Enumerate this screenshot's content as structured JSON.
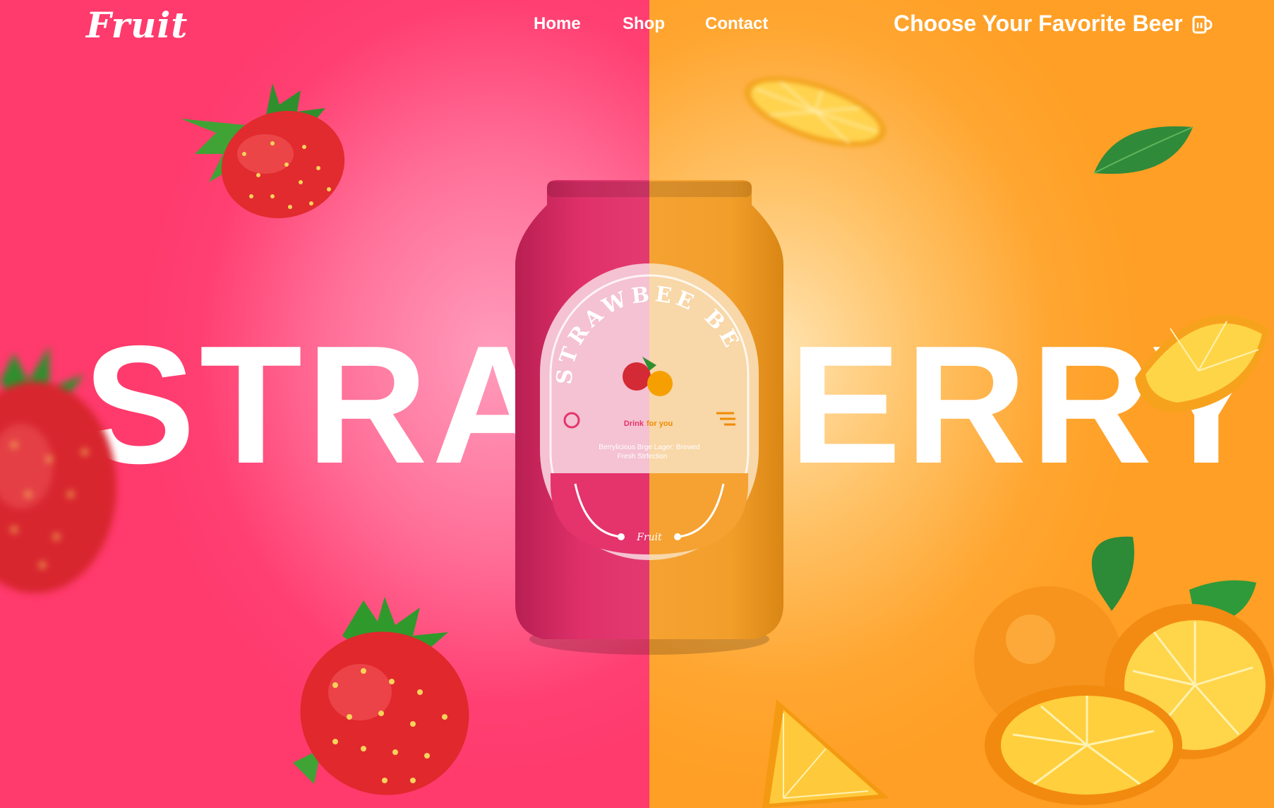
{
  "brand": {
    "logo": "Fruit"
  },
  "nav": {
    "items": [
      "Home",
      "Shop",
      "Contact"
    ]
  },
  "header": {
    "tagline": "Choose Your Favorite Beer",
    "cart_icon": "beer-mug-icon"
  },
  "hero": {
    "word_left": "STRA",
    "word_right": "ERRY"
  },
  "can": {
    "brand_arc": "STRAWBEE BEER",
    "drink_a": "Drink",
    "drink_b": "for you",
    "desc_line1": "Berrylicious Brge Lager: Brewed",
    "desc_line2": "Fresh Strfection",
    "foot_logo": "Fruit"
  },
  "colors": {
    "pink": "#ff3b6e",
    "orange": "#ffa12b",
    "can_pink": "#e0306a",
    "can_orange": "#f5a02e",
    "text": "#ffffff"
  }
}
